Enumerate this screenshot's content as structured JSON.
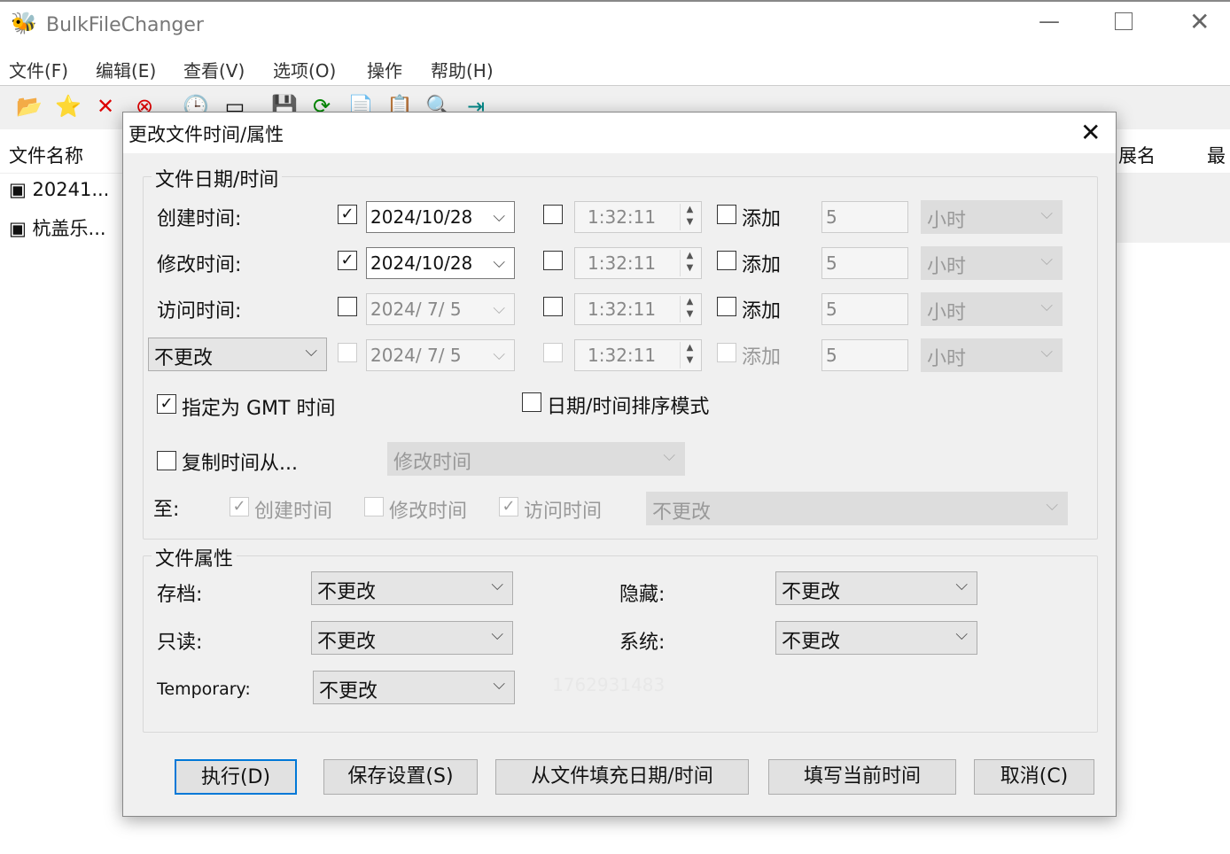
{
  "app": {
    "title": "BulkFileChanger"
  },
  "menu": [
    "文件(F)",
    "编辑(E)",
    "查看(V)",
    "选项(O)",
    "操作",
    "帮助(H)"
  ],
  "list": {
    "col_name": "文件名称",
    "col_ext": "展名",
    "col_last": "最",
    "files": [
      "20241...",
      "杭盖乐..."
    ]
  },
  "dialog": {
    "title": "更改文件时间/属性",
    "date_group": "文件日期/时间",
    "rows": [
      {
        "label": "创建时间:",
        "date": "2024/10/28",
        "time": "1:32:11",
        "add": "添加",
        "amount": "5",
        "unit": "小时"
      },
      {
        "label": "修改时间:",
        "date": "2024/10/28",
        "time": "1:32:11",
        "add": "添加",
        "amount": "5",
        "unit": "小时"
      },
      {
        "label": "访问时间:",
        "date": "2024/ 7/ 5",
        "time": "1:32:11",
        "add": "添加",
        "amount": "5",
        "unit": "小时"
      },
      {
        "label": "不更改",
        "date": "2024/ 7/ 5",
        "time": "1:32:11",
        "add": "添加",
        "amount": "5",
        "unit": "小时"
      }
    ],
    "gmt": "指定为 GMT 时间",
    "sort_mode": "日期/时间排序模式",
    "copy_from": "复制时间从...",
    "copy_source": "修改时间",
    "to": "至:",
    "to_created": "创建时间",
    "to_modified": "修改时间",
    "to_accessed": "访问时间",
    "to_combo": "不更改",
    "attr_group": "文件属性",
    "attrs": {
      "archive": "存档:",
      "readonly": "只读:",
      "temporary": "Temporary:",
      "hidden": "隐藏:",
      "system": "系统:",
      "value": "不更改"
    },
    "watermark": "1762931483",
    "buttons": {
      "execute": "执行(D)",
      "save": "保存设置(S)",
      "fill_from_file": "从文件填充日期/时间",
      "fill_now": "填写当前时间",
      "cancel": "取消(C)"
    }
  }
}
